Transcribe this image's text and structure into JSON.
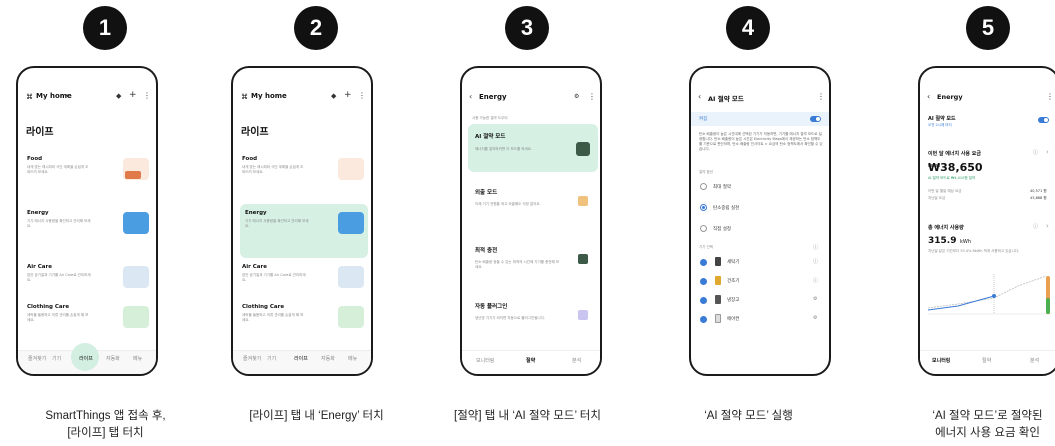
{
  "steps": [
    {
      "badge": "1",
      "caption": [
        "SmartThings 앱 접속 후,",
        "[라이프] 탭 터치"
      ]
    },
    {
      "badge": "2",
      "caption": [
        "[라이프] 탭 내 ‘Energy’ 터치"
      ]
    },
    {
      "badge": "3",
      "caption": [
        "[절약] 탭 내 ‘AI 절약 모드’ 터치"
      ]
    },
    {
      "badge": "4",
      "caption": [
        "‘AI 절약 모드’ 실행"
      ]
    },
    {
      "badge": "5",
      "caption": [
        "‘AI 절약 모드’로 절약된",
        "에너지 사용 요금 확인"
      ]
    }
  ],
  "life": {
    "home_title": "My home",
    "page_title": "라이프",
    "cards": [
      {
        "title": "Food",
        "desc": "내게 맞는 레시피와 식단 계획을 손쉽게 도와드려 보세요."
      },
      {
        "title": "Energy",
        "desc": "기기 에너지 사용량을 확인하고 관리해 보세요."
      },
      {
        "title": "Air Care",
        "desc": "집안 공기질과 기기를 Air Care로 관리하세요."
      },
      {
        "title": "Clothing Care",
        "desc": "세탁물 돌봄하고 의류 관리를 손쉽게 해 보세요."
      }
    ],
    "nav": [
      "즐겨찾기",
      "기기",
      "라이프",
      "자동화",
      "메뉴"
    ]
  },
  "energy": {
    "title": "Energy",
    "section_label": "사용 가능한 절약 도우미",
    "modes": [
      {
        "title": "AI 절약 모드",
        "desc": "에너지를 절약하려면 이 모드를 켜세요."
      },
      {
        "title": "외출 모드",
        "desc": "이제 기기 전원을 켜고 외출해도 걱정 없어요."
      },
      {
        "title": "최적 충전",
        "desc": "탄소 배출량 등을 수 있는 최적의 시간에 기기를 충전해 보세요."
      },
      {
        "title": "자동 플러그인",
        "desc": "냉난방 기기가 켜지면 자동으로 플러그인됩니다."
      }
    ],
    "tabs": [
      "모니터링",
      "절약",
      "분석"
    ]
  },
  "ai": {
    "title": "AI 절약 모드",
    "toggle_label": "켜짐",
    "description": "탄소 배출량이 높은 시간대에 선택된 기기가 작동하면, 기기를 에너지 절약 모드로 설정합니다. 탄소 배출량이 높은 시간은 Electricity Maps에서 제공하는 탄소 정책도를 기준으로 판단하며, 탄소 배출량 인사이트 > 요금의 탄소 정책도에서 확인할 수 있습니다.",
    "option_label": "절약 옵션",
    "options": [
      "최대 절약",
      "탄소중립 실천",
      "직접 설정"
    ],
    "devices_label": "기기 선택",
    "devices": [
      "세탁기",
      "건조기",
      "냉장고",
      "에어컨"
    ]
  },
  "result": {
    "title": "Energy",
    "ai_label": "AI 절약 모드",
    "ai_sub": "오전 2시에 마지",
    "monthly_label": "이번 달 에너지 사용 요금",
    "amount": "₩38,650",
    "saved": "AI 절약 모드로 ₩4,410원 절약",
    "rows": [
      {
        "label": "이번 달 월말 예상 요금",
        "value": "40,571 원"
      },
      {
        "label": "지난달 요금",
        "value": "43,888 원"
      }
    ],
    "total_label": "총 에너지 사용량",
    "total_value": "315.9",
    "total_unit": "kWh",
    "total_desc": "지난달 같은 기간보다 53.4% 6kWh 적게 사용하고 있습니다.",
    "tabs": [
      "모니터링",
      "절약",
      "분석"
    ]
  }
}
